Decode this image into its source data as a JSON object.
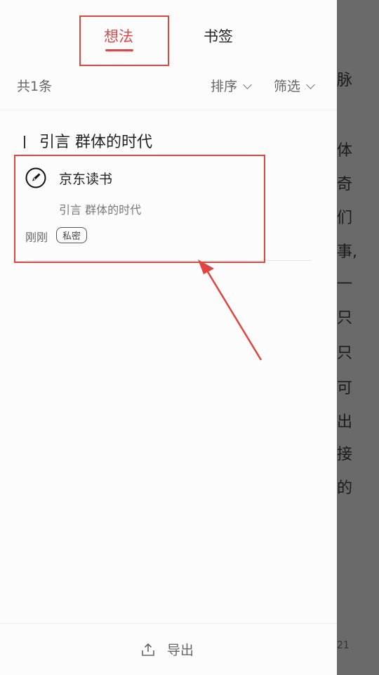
{
  "tabs": [
    {
      "label": "想法",
      "active": true
    },
    {
      "label": "书签",
      "active": false
    }
  ],
  "toolbar": {
    "count_label": "共1条",
    "sort_label": "排序",
    "filter_label": "筛选"
  },
  "chapter": {
    "title": "引言 群体的时代"
  },
  "note": {
    "source": "京东读书",
    "quote": "引言 群体的时代",
    "time": "刚刚",
    "badge": "私密"
  },
  "footer": {
    "export_label": "导出"
  },
  "reader": {
    "chars": [
      "脉",
      "体",
      "奇",
      "们",
      "事,",
      "一",
      "只",
      "只",
      "可",
      "出",
      "接",
      "的"
    ],
    "page": "21"
  },
  "colors": {
    "accent": "#d84a4a",
    "annotation": "#e0453f"
  }
}
